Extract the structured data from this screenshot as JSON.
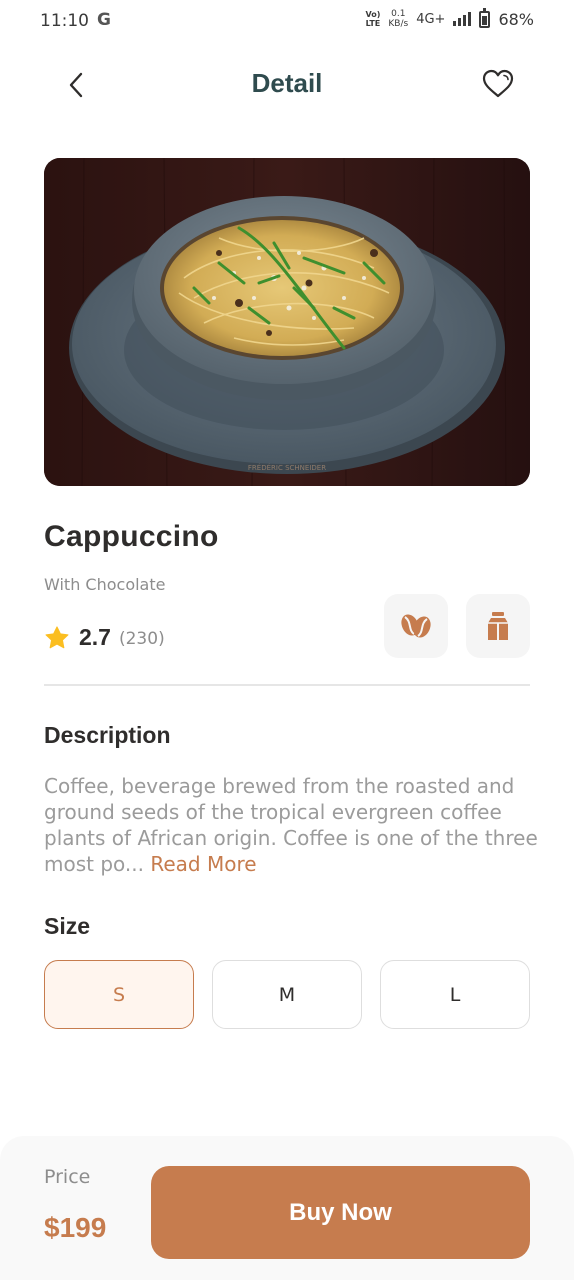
{
  "status_bar": {
    "time": "11:10",
    "carrier_icon": "G",
    "volte_top": "Vo)",
    "volte_bottom": "LTE",
    "speed_value": "0.1",
    "speed_unit": "KB/s",
    "network": "4G+",
    "battery": "68%"
  },
  "header": {
    "title": "Detail",
    "back_icon": "chevron-left-icon",
    "favorite_icon": "heart-outline-icon"
  },
  "product": {
    "name": "Cappuccino",
    "subtitle": "With Chocolate",
    "rating": "2.7",
    "rating_count": "(230)",
    "badges": [
      "coffee-bean-icon",
      "milk-carton-icon"
    ]
  },
  "description": {
    "title": "Description",
    "text": "Coffee, beverage brewed from the roasted and ground seeds of the tropical evergreen coffee plants of African origin. Coffee is one of the three most po... ",
    "read_more": "Read More"
  },
  "size": {
    "title": "Size",
    "options": [
      "S",
      "M",
      "L"
    ],
    "selected": "S"
  },
  "checkout": {
    "price_label": "Price",
    "price": "$199",
    "button_label": "Buy Now"
  },
  "colors": {
    "accent": "#c67c4e",
    "title_dark": "#2f4b4e",
    "text_dark": "#2f2d2c",
    "text_muted": "#8d8d8d",
    "star": "#fbbe21"
  }
}
